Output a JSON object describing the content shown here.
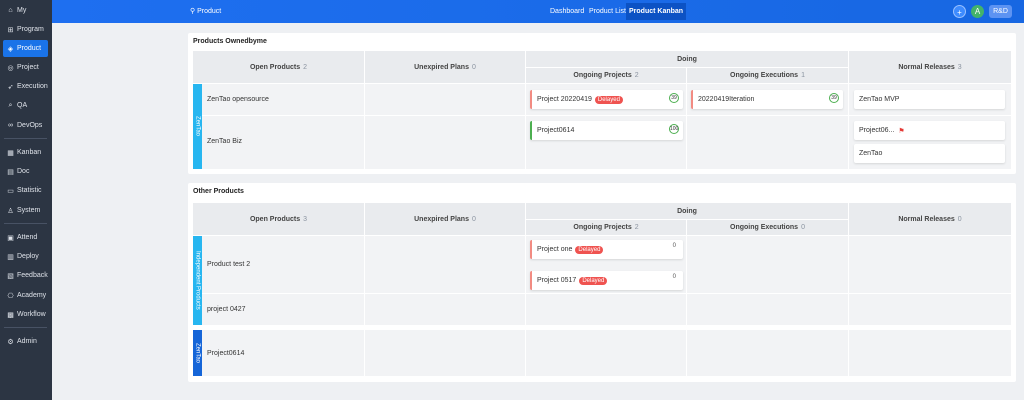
{
  "sidebar": {
    "items": [
      {
        "label": "My",
        "icon": "home-icon",
        "glyph": "⌂"
      },
      {
        "label": "Program",
        "icon": "grid-icon",
        "glyph": "⊞"
      },
      {
        "label": "Product",
        "icon": "product-icon",
        "glyph": "◈"
      },
      {
        "label": "Project",
        "icon": "project-icon",
        "glyph": "◎"
      },
      {
        "label": "Execution",
        "icon": "rocket-icon",
        "glyph": "➶"
      },
      {
        "label": "QA",
        "icon": "search-icon",
        "glyph": "⌕"
      },
      {
        "label": "DevOps",
        "icon": "infinity-icon",
        "glyph": "∞"
      },
      {
        "label": "Kanban",
        "icon": "kanban-icon",
        "glyph": "▦"
      },
      {
        "label": "Doc",
        "icon": "doc-icon",
        "glyph": "▤"
      },
      {
        "label": "Statistic",
        "icon": "chart-icon",
        "glyph": "▭"
      },
      {
        "label": "System",
        "icon": "users-icon",
        "glyph": "♙"
      },
      {
        "label": "Attend",
        "icon": "calendar-icon",
        "glyph": "▣"
      },
      {
        "label": "Deploy",
        "icon": "deploy-icon",
        "glyph": "▥"
      },
      {
        "label": "Feedback",
        "icon": "feedback-icon",
        "glyph": "▧"
      },
      {
        "label": "Academy",
        "icon": "academy-icon",
        "glyph": "⎔"
      },
      {
        "label": "Workflow",
        "icon": "workflow-icon",
        "glyph": "▩"
      },
      {
        "label": "Admin",
        "icon": "admin-icon",
        "glyph": "⚙"
      }
    ]
  },
  "topbar": {
    "breadcrumb": "Product",
    "tabs": [
      "Dashboard",
      "Product List",
      "Product Kanban"
    ],
    "avatar": "A",
    "role": "R&D",
    "accent": "#1a73e8"
  },
  "headers": {
    "open_products": "Open Products",
    "unexpired_plans": "Unexpired Plans",
    "doing": "Doing",
    "ongoing_projects": "Ongoing Projects",
    "ongoing_executions": "Ongoing Executions",
    "normal_releases": "Normal Releases"
  },
  "owned": {
    "title": "Products Ownedbyme",
    "counts": {
      "open": "2",
      "plans": "0",
      "projects": "2",
      "executions": "1",
      "releases": "3"
    },
    "group": "ZenTao",
    "products": [
      "ZenTao opensource",
      "ZenTao Biz"
    ],
    "projects": [
      {
        "name": "Project 20220419",
        "badge": "Delayed",
        "progress": "39"
      },
      {
        "name": "Project0614",
        "progress": "100"
      }
    ],
    "execution": {
      "name": "20220419Iteration",
      "progress": "39"
    },
    "releases": [
      "ZenTao MVP",
      "Project06...",
      "ZenTao"
    ]
  },
  "other": {
    "title": "Other Products",
    "counts": {
      "open": "3",
      "plans": "0",
      "projects": "2",
      "executions": "0",
      "releases": "0"
    },
    "groups": [
      "Independent Products",
      "ZenTao"
    ],
    "products": [
      "Product test 2",
      "project 0427",
      "Project0614"
    ],
    "projects": [
      {
        "name": "Project one",
        "badge": "Delayed",
        "progress": "0"
      },
      {
        "name": "Project 0517",
        "badge": "Delayed",
        "progress": "0"
      }
    ]
  }
}
